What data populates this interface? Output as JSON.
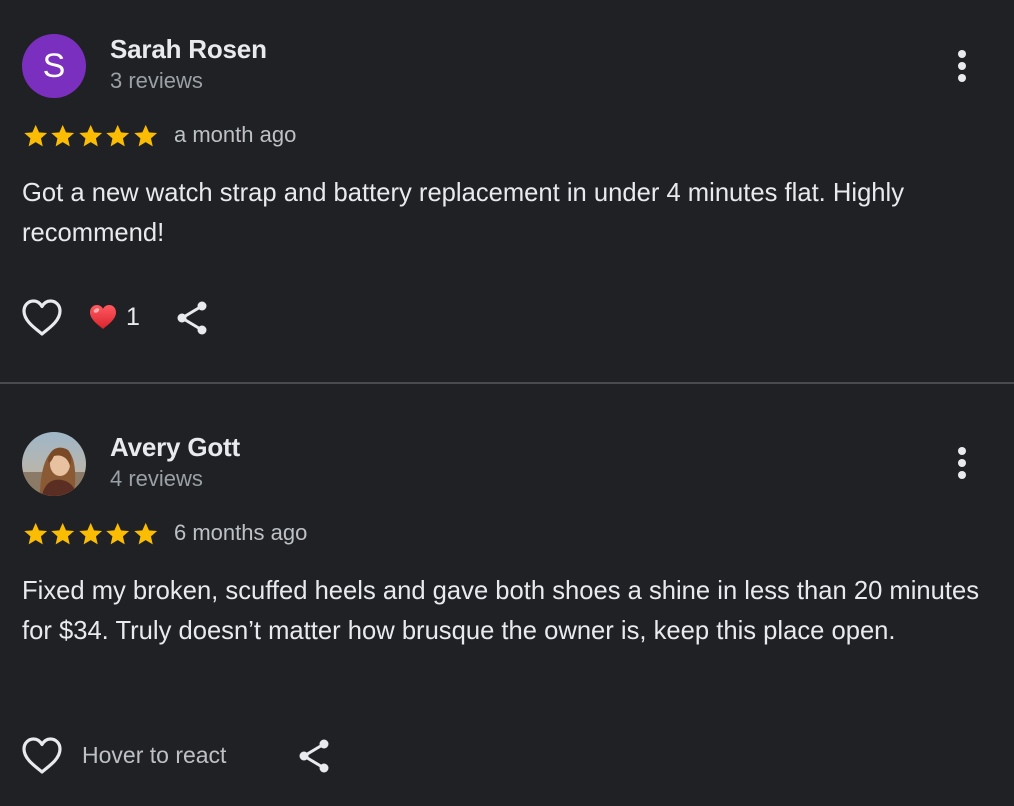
{
  "reviews": [
    {
      "author": "Sarah Rosen",
      "avatar_letter": "S",
      "review_count": "3 reviews",
      "rating": 5,
      "time": "a month ago",
      "text": "Got a new watch strap and battery replacement in under 4 minutes flat. Highly recommend!",
      "reaction_emoji": "❤️",
      "reaction_count": "1"
    },
    {
      "author": "Avery Gott",
      "avatar": "photo",
      "review_count": "4 reviews",
      "rating": 5,
      "time": "6 months ago",
      "text": "Fixed my broken, scuffed heels and gave both shoes a shine in less than 20 minutes for $34. Truly doesn’t matter how brusque the owner is, keep this place open.",
      "reaction_label": "Hover to react"
    }
  ],
  "icons": {
    "like": "heart-outline-icon",
    "share": "share-icon",
    "menu": "more-vertical-icon",
    "star": "star-icon"
  },
  "colors": {
    "background": "#202124",
    "star": "#fbbc04",
    "avatar_purple": "#7b2fbe",
    "text_primary": "#e8eaed",
    "text_secondary": "#9aa0a6"
  }
}
